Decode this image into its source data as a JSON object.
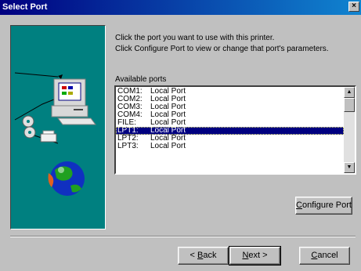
{
  "window": {
    "title": "Select Port",
    "close_glyph": "×"
  },
  "instructions": {
    "line1": "Click the port you want to use with this printer.",
    "line2": "Click Configure Port to view or change that port's parameters."
  },
  "ports": {
    "label": "Available ports",
    "items": [
      {
        "port": "COM1:",
        "desc": "Local Port"
      },
      {
        "port": "COM2:",
        "desc": "Local Port"
      },
      {
        "port": "COM3:",
        "desc": "Local Port"
      },
      {
        "port": "COM4:",
        "desc": "Local Port"
      },
      {
        "port": "FILE:",
        "desc": "Local Port"
      },
      {
        "port": "LPT1:",
        "desc": "Local Port"
      },
      {
        "port": "LPT2:",
        "desc": "Local Port"
      },
      {
        "port": "LPT3:",
        "desc": "Local Port"
      }
    ],
    "selected": "LPT1:"
  },
  "buttons": {
    "configure": {
      "accel": "C",
      "rest": "onfigure Port"
    },
    "back": {
      "prefix": "< ",
      "accel": "B",
      "rest": "ack"
    },
    "next": {
      "accel": "N",
      "rest": "ext >"
    },
    "cancel": {
      "accel": "C",
      "rest": "ancel"
    }
  },
  "colors": {
    "teal": "#008080",
    "selection": "#000080",
    "titlebar": "#000080"
  }
}
